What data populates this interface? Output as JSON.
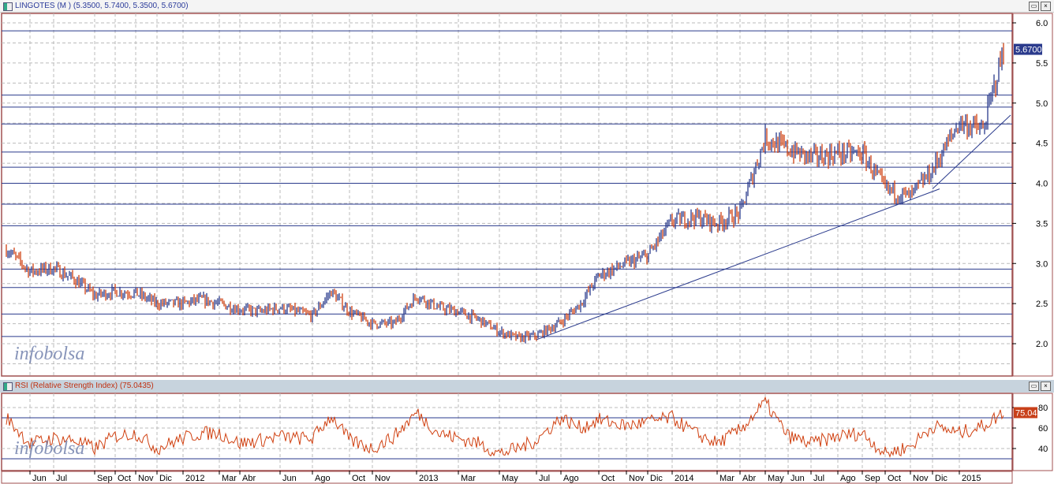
{
  "price_panel": {
    "title": "LINGOTES (M ) (5.3500, 5.7400, 5.3500, 5.6700)",
    "last_label": "5.6700"
  },
  "rsi_panel": {
    "title": "RSI (Relative Strength Index) (75.0435)",
    "last_label": "75.04"
  },
  "watermark": "infobolsa",
  "buttons": {
    "maximize": "▭",
    "close": "×"
  },
  "colors": {
    "up": "#2a3a8c",
    "down": "#d04010",
    "rsi": "#d04010",
    "levels": "#2a3a8c",
    "border": "#a05050"
  },
  "chart_data": [
    {
      "type": "ohlc",
      "ylim": [
        1.6,
        6.1
      ],
      "yticks": [
        "6.0",
        "5.5",
        "5.0",
        "4.5",
        "4.0",
        "3.5",
        "3.0",
        "2.5",
        "2.0"
      ],
      "grid": true,
      "horizontal_levels": [
        5.9,
        5.1,
        4.95,
        4.74,
        4.39,
        4.2,
        4.0,
        3.74,
        3.47,
        2.93,
        2.7,
        2.37,
        2.09
      ],
      "trendlines": [
        [
          [
            "2013-07",
            2.05
          ],
          [
            "2014-12",
            3.93
          ]
        ],
        [
          [
            "2014-12",
            3.93
          ],
          [
            "2015-03",
            4.85
          ]
        ]
      ],
      "last": 5.67,
      "series": {
        "dates": [
          "2011-05",
          "2011-06",
          "2011-07",
          "2011-08",
          "2011-09",
          "2011-10",
          "2011-11",
          "2011-12",
          "2012-01",
          "2012-02",
          "2012-03",
          "2012-04",
          "2012-05",
          "2012-06",
          "2012-07",
          "2012-08",
          "2012-09",
          "2012-10",
          "2012-11",
          "2012-12",
          "2013-01",
          "2013-02",
          "2013-03",
          "2013-04",
          "2013-05",
          "2013-06",
          "2013-07",
          "2013-08",
          "2013-09",
          "2013-10",
          "2013-11",
          "2013-12",
          "2014-01",
          "2014-02",
          "2014-03",
          "2014-04",
          "2014-05",
          "2014-06",
          "2014-07",
          "2014-08",
          "2014-09",
          "2014-10",
          "2014-11",
          "2014-12",
          "2015-01",
          "2015-02",
          "2015-03"
        ],
        "close": [
          3.18,
          2.9,
          2.94,
          2.8,
          2.6,
          2.65,
          2.63,
          2.5,
          2.5,
          2.55,
          2.5,
          2.43,
          2.4,
          2.45,
          2.4,
          2.35,
          2.65,
          2.4,
          2.25,
          2.25,
          2.6,
          2.45,
          2.4,
          2.3,
          2.15,
          2.07,
          2.1,
          2.27,
          2.5,
          2.85,
          3.0,
          3.1,
          3.53,
          3.58,
          3.5,
          3.63,
          4.57,
          4.42,
          4.32,
          4.37,
          4.37,
          3.93,
          3.83,
          4.17,
          4.76,
          4.66,
          5.67
        ]
      }
    },
    {
      "type": "line",
      "ylim": [
        22,
        92
      ],
      "yticks": [
        "80",
        "60",
        "40"
      ],
      "horizontal_levels": [
        70,
        30
      ],
      "last": 75.04,
      "series": {
        "dates": [
          "2011-05",
          "2011-06",
          "2011-07",
          "2011-08",
          "2011-09",
          "2011-10",
          "2011-11",
          "2011-12",
          "2012-01",
          "2012-02",
          "2012-03",
          "2012-04",
          "2012-05",
          "2012-06",
          "2012-07",
          "2012-08",
          "2012-09",
          "2012-10",
          "2012-11",
          "2012-12",
          "2013-01",
          "2013-02",
          "2013-03",
          "2013-04",
          "2013-05",
          "2013-06",
          "2013-07",
          "2013-08",
          "2013-09",
          "2013-10",
          "2013-11",
          "2013-12",
          "2014-01",
          "2014-02",
          "2014-03",
          "2014-04",
          "2014-05",
          "2014-06",
          "2014-07",
          "2014-08",
          "2014-09",
          "2014-10",
          "2014-11",
          "2014-12",
          "2015-01",
          "2015-02",
          "2015-03"
        ],
        "values": [
          70,
          45,
          50,
          48,
          40,
          52,
          55,
          40,
          50,
          55,
          55,
          45,
          48,
          52,
          50,
          50,
          72,
          48,
          40,
          52,
          75,
          55,
          50,
          45,
          35,
          40,
          48,
          70,
          60,
          68,
          62,
          66,
          70,
          55,
          45,
          58,
          85,
          52,
          45,
          52,
          55,
          35,
          42,
          62,
          55,
          62,
          75
        ]
      }
    }
  ],
  "x_axis_labels": [
    "Jun",
    "Jul",
    "Sep",
    "Oct",
    "Nov",
    "Dic",
    "2012",
    "Mar",
    "Abr",
    "Jun",
    "Ago",
    "Oct",
    "Nov",
    "2013",
    "Mar",
    "May",
    "Jul",
    "Ago",
    "Oct",
    "Nov",
    "Dic",
    "2014",
    "Mar",
    "Abr",
    "May",
    "Jun",
    "Jul",
    "Ago",
    "Sep",
    "Oct",
    "Nov",
    "Dic",
    "2015"
  ]
}
